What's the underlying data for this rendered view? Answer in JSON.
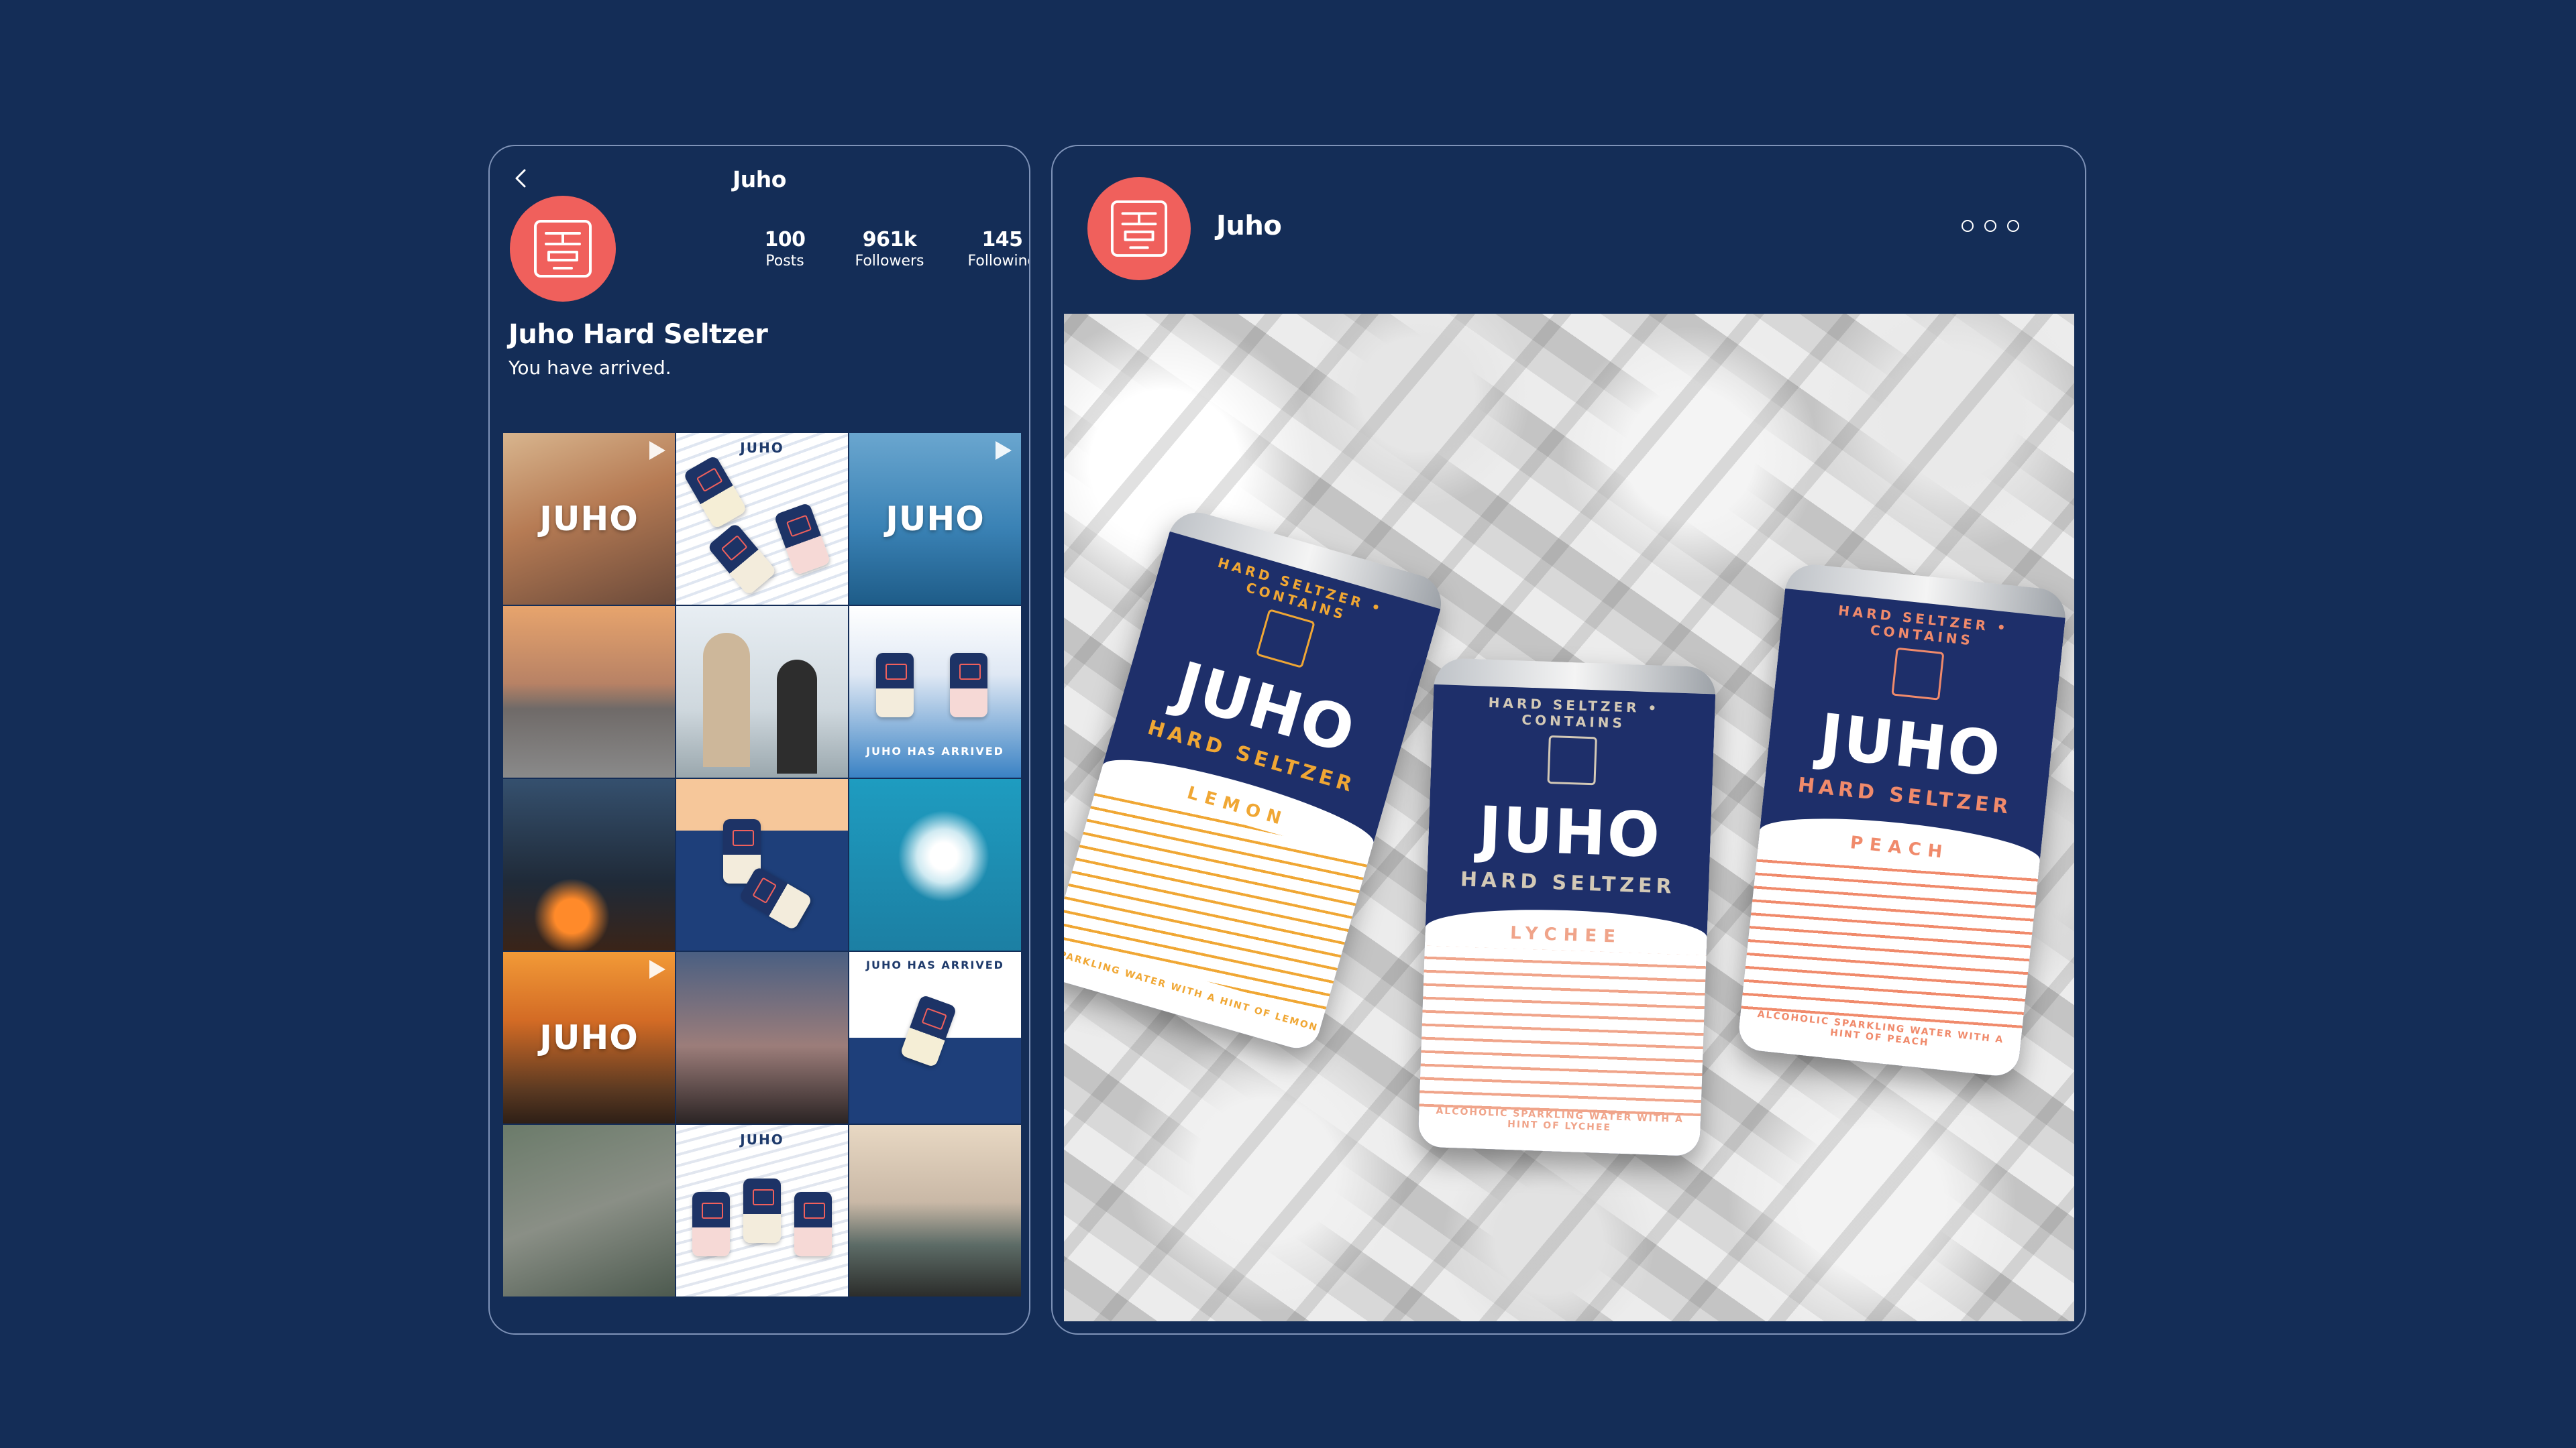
{
  "colors": {
    "background": "#142d57",
    "accent_coral": "#f0605c",
    "lemon": "#f0a734",
    "lychee": "#f0a48a",
    "peach": "#f08a6b"
  },
  "profile": {
    "title": "Juho",
    "back_icon": "chevron-left-icon",
    "stats": [
      {
        "value": "100",
        "label": "Posts"
      },
      {
        "value": "961k",
        "label": "Followers"
      },
      {
        "value": "145",
        "label": "Following"
      }
    ],
    "bio_name": "Juho Hard Seltzer",
    "bio_text": "You have arrived."
  },
  "grid": {
    "tiles": [
      {
        "overlay": "JUHO",
        "reel": true
      },
      {
        "caption": "JUHO"
      },
      {
        "overlay": "JUHO",
        "reel": true
      },
      {},
      {},
      {
        "caption_bottom": "JUHO HAS ARRIVED"
      },
      {},
      {},
      {},
      {
        "overlay": "JUHO",
        "reel": true
      },
      {},
      {
        "caption": "JUHO HAS ARRIVED",
        "reel": true
      },
      {},
      {
        "caption": "JUHO"
      },
      {}
    ]
  },
  "post": {
    "author": "Juho",
    "more_icon": "more-options-icon",
    "cans": {
      "lemon": {
        "ring": "HARD SELTZER • CONTAINS",
        "brand": "JUHO",
        "sub": "HARD SELTZER",
        "flavor": "LEMON",
        "desc": "SPARKLING WATER WITH A HINT OF LEMON"
      },
      "lychee": {
        "ring": "HARD SELTZER • CONTAINS",
        "brand": "JUHO",
        "sub": "HARD SELTZER",
        "flavor": "LYCHEE",
        "desc": "ALCOHOLIC SPARKLING WATER WITH A HINT OF LYCHEE"
      },
      "peach": {
        "ring": "HARD SELTZER • CONTAINS",
        "brand": "JUHO",
        "sub": "HARD SELTZER",
        "flavor": "PEACH",
        "desc": "ALCOHOLIC SPARKLING WATER WITH A HINT OF PEACH"
      }
    }
  }
}
